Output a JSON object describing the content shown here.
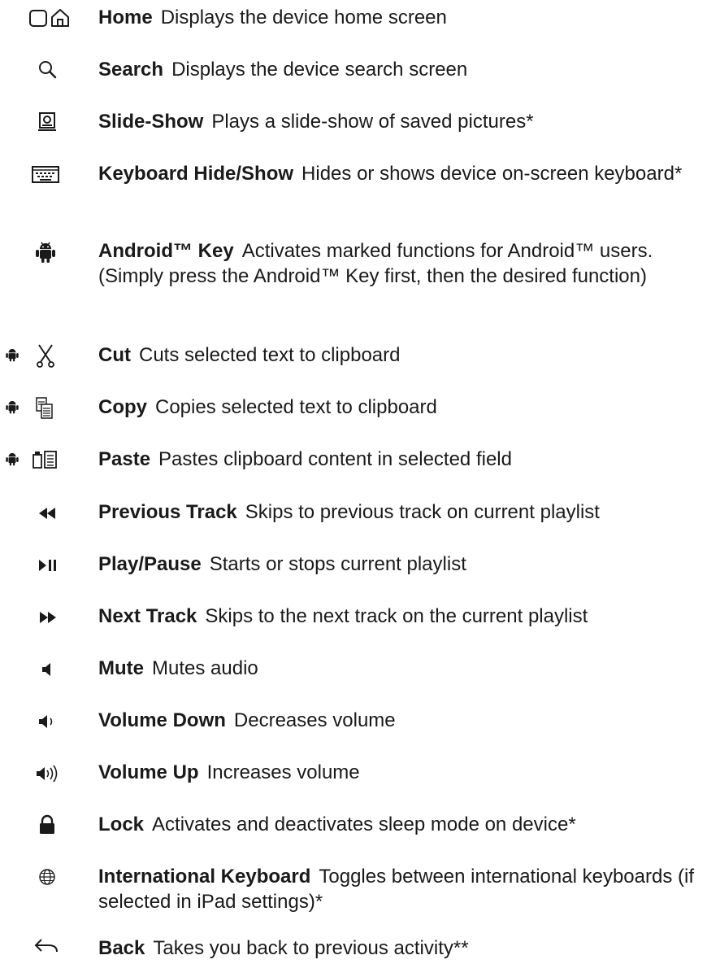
{
  "entries": [
    {
      "icon": "home-icon",
      "term": "Home",
      "description": "Displays the device home screen"
    },
    {
      "icon": "search-icon",
      "term": "Search",
      "description": "Displays the device search screen"
    },
    {
      "icon": "slideshow-icon",
      "term": "Slide-Show",
      "description": "Plays a slide-show of saved pictures*"
    },
    {
      "icon": "keyboard-icon",
      "term": "Keyboard Hide/Show",
      "description": "Hides or shows device on-screen keyboard*"
    },
    {
      "icon": "android-icon",
      "term": "Android™ Key",
      "description": "Activates marked functions for Android™ users. (Simply press the Android™ Key first, then the desired function)"
    },
    {
      "icon": "scissors-icon",
      "term": "Cut",
      "description": "Cuts selected text to clipboard"
    },
    {
      "icon": "copy-icon",
      "term": "Copy",
      "description": "Copies selected text to clipboard"
    },
    {
      "icon": "paste-icon",
      "term": "Paste",
      "description": "Pastes clipboard content in selected field"
    },
    {
      "icon": "previous-track-icon",
      "term": "Previous Track",
      "description": "Skips to previous track on current playlist"
    },
    {
      "icon": "play-pause-icon",
      "term": "Play/Pause",
      "description": "Starts or stops current playlist"
    },
    {
      "icon": "next-track-icon",
      "term": "Next Track",
      "description": "Skips to the next track on the current playlist"
    },
    {
      "icon": "mute-icon",
      "term": "Mute",
      "description": "Mutes audio"
    },
    {
      "icon": "volume-down-icon",
      "term": "Volume Down",
      "description": "Decreases volume"
    },
    {
      "icon": "volume-up-icon",
      "term": "Volume Up",
      "description": "Increases volume"
    },
    {
      "icon": "lock-icon",
      "term": "Lock",
      "description": "Activates and deactivates sleep mode on device*"
    },
    {
      "icon": "globe-icon",
      "term": "International Keyboard",
      "description": "Toggles between international keyboards (if selected in iPad settings)*"
    },
    {
      "icon": "back-arrow-icon",
      "term": "Back",
      "description": "Takes you back to previous activity**"
    }
  ]
}
